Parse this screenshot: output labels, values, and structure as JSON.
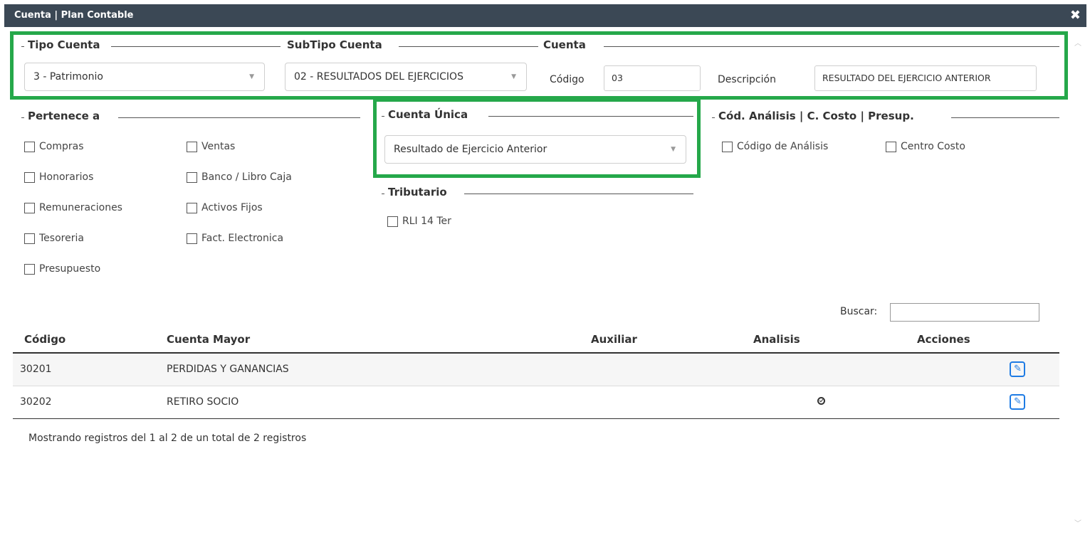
{
  "window": {
    "title": "Cuenta | Plan Contable",
    "close_symbol": "✖"
  },
  "tipo_cuenta": {
    "title": "Tipo Cuenta",
    "selected": "3 - Patrimonio"
  },
  "subtipo_cuenta": {
    "title": "SubTipo Cuenta",
    "selected": "02 - RESULTADOS DEL EJERCICIOS"
  },
  "cuenta": {
    "title": "Cuenta",
    "codigo_label": "Código",
    "codigo_value": "03",
    "descripcion_label": "Descripción",
    "descripcion_value": "RESULTADO DEL EJERCICIO ANTERIOR"
  },
  "pertenece": {
    "title": "Pertenece a",
    "items": [
      "Compras",
      "Ventas",
      "Honorarios",
      "Banco / Libro Caja",
      "Remuneraciones",
      "Activos Fijos",
      "Tesoreria",
      "Fact. Electronica",
      "Presupuesto"
    ]
  },
  "cuenta_unica": {
    "title": "Cuenta Única",
    "selected": "Resultado de Ejercicio Anterior"
  },
  "tributario": {
    "title": "Tributario",
    "items": [
      "RLI 14 Ter"
    ]
  },
  "analisis": {
    "title": "Cód. Análisis | C. Costo | Presup.",
    "items": [
      "Código de Análisis",
      "Centro Costo"
    ]
  },
  "search": {
    "label": "Buscar:",
    "value": ""
  },
  "table": {
    "headers": [
      "Código",
      "Cuenta Mayor",
      "Auxiliar",
      "Analisis",
      "Acciones"
    ],
    "rows": [
      {
        "codigo": "30201",
        "cuenta": "PERDIDAS Y GANANCIAS",
        "auxiliar": "",
        "analisis": false
      },
      {
        "codigo": "30202",
        "cuenta": "RETIRO SOCIO",
        "auxiliar": "",
        "analisis": true
      }
    ]
  },
  "footer": {
    "info": "Mostrando registros del 1 al 2 de un total de 2 registros"
  },
  "colors": {
    "title_bg": "#3b4855",
    "highlight": "#25a84a",
    "edit_button": "#1e7be4"
  }
}
